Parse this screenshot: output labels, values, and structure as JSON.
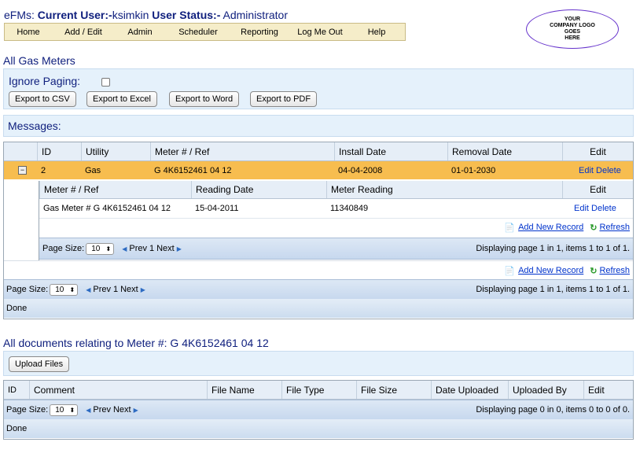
{
  "header": {
    "app": "eFMs:",
    "current_user_label": "Current User:-",
    "current_user": "ksimkin",
    "status_label": "User Status:-",
    "status": "Administrator"
  },
  "menu": [
    "Home",
    "Add / Edit",
    "Admin",
    "Scheduler",
    "Reporting",
    "Log Me Out",
    "Help"
  ],
  "logo_text": "YOUR\nCOMPANY LOGO\nGOES\nHERE",
  "meters": {
    "title": "All Gas Meters",
    "ignore_paging": "Ignore Paging:",
    "exports": [
      "Export to CSV",
      "Export to Excel",
      "Export to Word",
      "Export to PDF"
    ],
    "messages": "Messages:",
    "columns": [
      "ID",
      "Utility",
      "Meter # / Ref",
      "Install Date",
      "Removal Date",
      "Edit"
    ],
    "row": {
      "id": "2",
      "utility": "Gas",
      "meter": "G 4K6152461 04 12",
      "install": "04-04-2008",
      "removal": "01-01-2030",
      "edit": "Edit",
      "delete": "Delete"
    },
    "detail": {
      "columns": [
        "Meter # / Ref",
        "Reading Date",
        "Meter Reading",
        "Edit"
      ],
      "row": {
        "meter": "Gas Meter # G 4K6152461 04 12",
        "date": "15-04-2011",
        "reading": "11340849",
        "edit": "Edit",
        "delete": "Delete"
      },
      "add_new": "Add New Record",
      "refresh": "Refresh",
      "page_size_label": "Page Size:",
      "page_size": "10",
      "prev": "Prev",
      "page": "1",
      "next": "Next",
      "displaying": "Displaying page 1 in 1, items 1 to 1 of 1."
    },
    "add_new": "Add New Record",
    "refresh": "Refresh",
    "page_size_label": "Page Size:",
    "page_size": "10",
    "prev": "Prev",
    "page": "1",
    "next": "Next",
    "displaying": "Displaying page 1 in 1, items 1 to 1 of 1.",
    "done": "Done"
  },
  "documents": {
    "title": "All documents relating to Meter #: G 4K6152461 04 12",
    "upload": "Upload Files",
    "columns": [
      "ID",
      "Comment",
      "File Name",
      "File Type",
      "File Size",
      "Date Uploaded",
      "Uploaded By",
      "Edit"
    ],
    "page_size_label": "Page Size:",
    "page_size": "10",
    "prev": "Prev",
    "next": "Next",
    "displaying": "Displaying page 0 in 0, items 0 to 0 of 0.",
    "done": "Done"
  },
  "colors": {
    "selected_row": "#f7bd4f",
    "link": "#0033cc",
    "title": "#10207e"
  }
}
